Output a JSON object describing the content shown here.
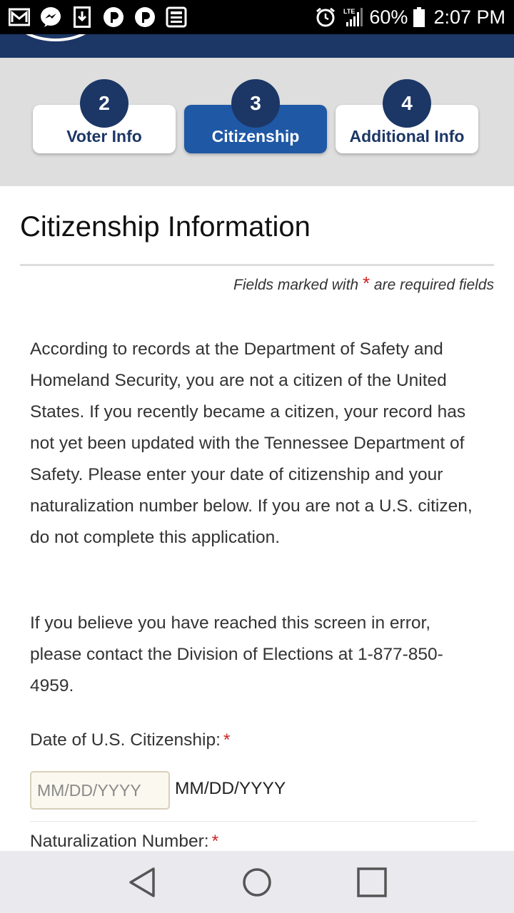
{
  "status_bar": {
    "battery_percent": "60%",
    "time": "2:07 PM",
    "network": "LTE",
    "notification_icons": [
      "gmail-icon",
      "messenger-icon",
      "download-icon",
      "pandora-icon",
      "pandora-icon",
      "news-icon"
    ],
    "system_icons": [
      "alarm-icon",
      "signal-icon",
      "battery-icon"
    ]
  },
  "steps": [
    {
      "number": "2",
      "label": "Voter Info",
      "active": false
    },
    {
      "number": "3",
      "label": "Citizenship",
      "active": true
    },
    {
      "number": "4",
      "label": "Additional Info",
      "active": false
    }
  ],
  "page": {
    "title": "Citizenship Information",
    "required_note_prefix": "Fields marked with",
    "required_star": "*",
    "required_note_suffix": "are required fields",
    "paragraph1": "According to records at the Department of Safety and Homeland Security, you are not a citizen of the United States. If you recently became a citizen, your record has not yet been updated with the Tennessee Department of Safety. Please enter your date of citizenship and your naturalization number below. If you are not a U.S. citizen, do not complete this application.",
    "paragraph2": "If you believe you have reached this screen in error, please contact the Division of Elections at 1-877-850-4959."
  },
  "form": {
    "date_label": "Date of U.S. Citizenship:",
    "date_placeholder": "MM/DD/YYYY",
    "date_value": "",
    "date_format_hint": "MM/DD/YYYY",
    "naturalization_label": "Naturalization Number:",
    "required_star": "*"
  },
  "nav_bar": [
    "back-icon",
    "home-icon",
    "recents-icon"
  ],
  "colors": {
    "header_navy": "#1c3766",
    "active_step": "#1f58a5",
    "required_red": "#cc2222",
    "steps_background": "#dedede"
  }
}
